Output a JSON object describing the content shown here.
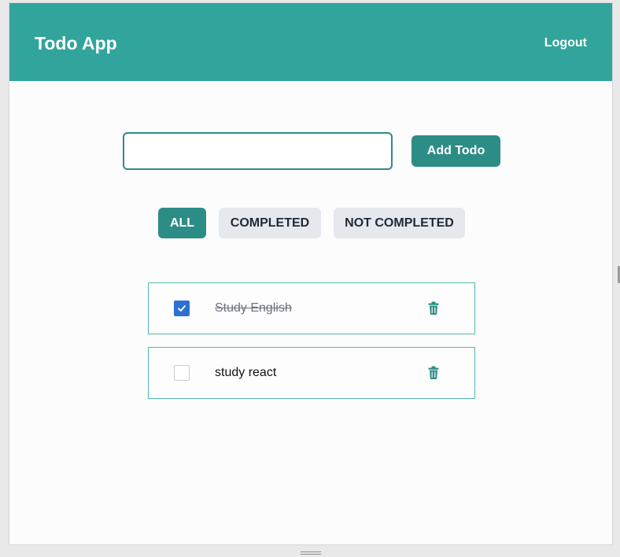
{
  "header": {
    "title": "Todo App",
    "logout_label": "Logout"
  },
  "new_todo": {
    "value": "",
    "placeholder": "",
    "add_label": "Add Todo"
  },
  "filters": [
    {
      "label": "ALL",
      "active": true
    },
    {
      "label": "COMPLETED",
      "active": false
    },
    {
      "label": "NOT COMPLETED",
      "active": false
    }
  ],
  "todos": [
    {
      "text": "Study English",
      "completed": true
    },
    {
      "text": "study react",
      "completed": false
    }
  ],
  "colors": {
    "header_bg": "#31a49b",
    "primary": "#2c8d86",
    "checkbox_checked": "#2d6fd3",
    "item_border": "#4fb8b0",
    "filter_inactive_bg": "#e5e9ee"
  },
  "icons": {
    "delete": "trash-icon",
    "check": "checkmark-icon"
  }
}
